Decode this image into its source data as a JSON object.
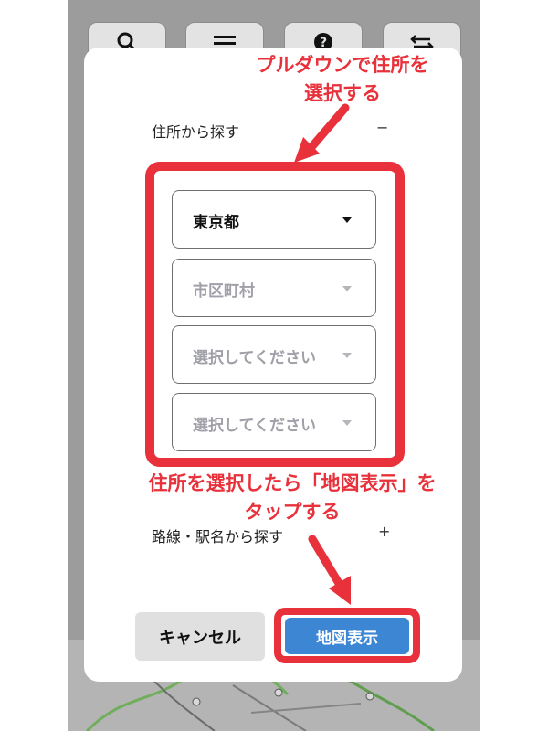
{
  "toolbar": {
    "icons": [
      "search-icon",
      "menu-icon",
      "help-icon",
      "swap-icon"
    ]
  },
  "modal": {
    "address_section": {
      "title": "住所から探す",
      "toggle": "−"
    },
    "selects": [
      {
        "value": "東京都",
        "state": "selected"
      },
      {
        "value": "市区町村",
        "state": "placeholder"
      },
      {
        "value": "選択してください",
        "state": "placeholder"
      },
      {
        "value": "選択してください",
        "state": "placeholder"
      }
    ],
    "route_section": {
      "title": "路線・駅名から探す",
      "toggle": "+"
    },
    "buttons": {
      "cancel": "キャンセル",
      "show_map": "地図表示"
    }
  },
  "annotations": {
    "top_line1": "プルダウンで住所を",
    "top_line2": "選択する",
    "bottom_line1": "住所を選択したら「地図表示」を",
    "bottom_line2": "タップする"
  },
  "colors": {
    "highlight": "#e8313a",
    "primary_button": "#3d86d4",
    "overlay": "#9c9c9c"
  }
}
